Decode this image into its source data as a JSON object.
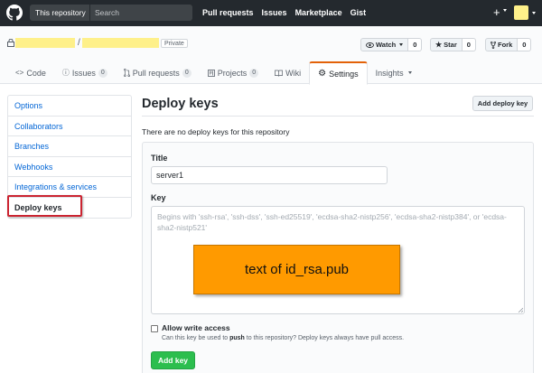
{
  "header": {
    "search_scope": "This repository",
    "search_placeholder": "Search",
    "nav": [
      "Pull requests",
      "Issues",
      "Marketplace",
      "Gist"
    ],
    "plus": "+"
  },
  "repo": {
    "slash": "/",
    "visibility": "Private",
    "watch": {
      "label": "Watch",
      "count": "0"
    },
    "star": {
      "label": "Star",
      "count": "0"
    },
    "fork": {
      "label": "Fork",
      "count": "0"
    }
  },
  "tabs": [
    {
      "label": "Code",
      "icon": "code-icon"
    },
    {
      "label": "Issues",
      "icon": "issue-icon",
      "counter": "0"
    },
    {
      "label": "Pull requests",
      "icon": "pull-request-icon",
      "counter": "0"
    },
    {
      "label": "Projects",
      "icon": "project-icon",
      "counter": "0"
    },
    {
      "label": "Wiki",
      "icon": "book-icon"
    },
    {
      "label": "Settings",
      "icon": "gear-icon",
      "selected": true
    },
    {
      "label": "Insights",
      "icon": "chevron-down-icon"
    }
  ],
  "sidebar": {
    "items": [
      "Options",
      "Collaborators",
      "Branches",
      "Webhooks",
      "Integrations & services",
      "Deploy keys"
    ],
    "selected": "Deploy keys"
  },
  "main": {
    "title": "Deploy keys",
    "add_button": "Add deploy key",
    "empty_message": "There are no deploy keys for this repository",
    "form": {
      "title_label": "Title",
      "title_value": "server1",
      "key_label": "Key",
      "key_placeholder": "Begins with 'ssh-rsa', 'ssh-dss', 'ssh-ed25519', 'ecdsa-sha2-nistp256', 'ecdsa-sha2-nistp384', or 'ecdsa-sha2-nistp521'",
      "overlay_text": "text of id_rsa.pub",
      "write_access_label": "Allow write access",
      "write_access_note_pre": "Can this key be used to ",
      "write_access_note_bold": "push",
      "write_access_note_post": " to this repository? Deploy keys always have pull access.",
      "submit": "Add key"
    }
  },
  "colors": {
    "header_bg": "#24292e",
    "link": "#0366d6",
    "tab_accent": "#e36209",
    "primary_button": "#2cbe4e",
    "overlay": "#ff9a00",
    "highlight": "#cb2431",
    "redaction": "#fef08a"
  }
}
